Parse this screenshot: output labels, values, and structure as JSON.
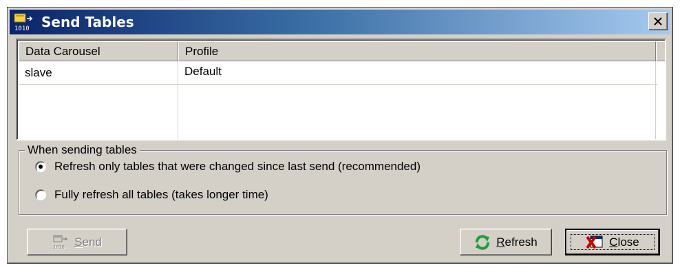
{
  "window": {
    "title": "Send Tables",
    "close_label": "×"
  },
  "list": {
    "columns": [
      "Data Carousel",
      "Profile"
    ],
    "rows": [
      {
        "carousel": "slave",
        "profile": "Default"
      }
    ]
  },
  "options": {
    "group_label": "When sending tables",
    "radios": [
      {
        "label": "Refresh only tables that were changed since last send (recommended)",
        "checked": true
      },
      {
        "label": "Fully refresh all tables (takes longer time)",
        "checked": false
      }
    ]
  },
  "buttons": {
    "send": {
      "mnemonic": "S",
      "rest": "end",
      "enabled": false,
      "icon": "send-tables-icon"
    },
    "refresh": {
      "mnemonic": "R",
      "rest": "efresh",
      "icon": "refresh-arrows-icon"
    },
    "close": {
      "mnemonic": "C",
      "rest": "lose",
      "icon": "close-window-icon"
    }
  },
  "colors": {
    "title_gradient_start": "#0a246a",
    "title_gradient_end": "#a6caf0",
    "face": "#d4d0c8",
    "refresh_green": "#1e9e3a",
    "close_red": "#cc0000"
  }
}
